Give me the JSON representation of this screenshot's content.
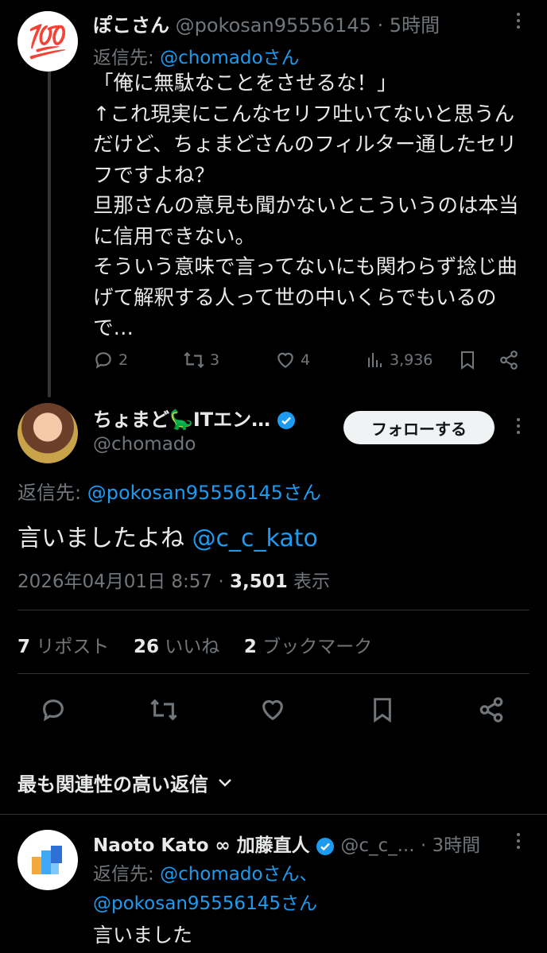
{
  "tweet1": {
    "author_name": "ぽこさん",
    "author_handle": "@pokosan95556145",
    "sep": "·",
    "time": "5時間",
    "reply_prefix": "返信先: ",
    "reply_to": "@chomadoさん",
    "avatar_emoji": "💯",
    "body": "「俺に無駄なことをさせるな！」\n↑これ現実にこんなセリフ吐いてないと思うんだけど、ちょまどさんのフィルター通したセリフですよね？\n旦那さんの意見も聞かないとこういうのは本当に信用できない。\nそういう意味で言ってないにも関わらず捻じ曲げて解釈する人って世の中いくらでもいるので…",
    "replies": "2",
    "reposts": "3",
    "likes": "4",
    "views": "3,936"
  },
  "tweet2": {
    "author_name": "ちょまど🦕ITエン…",
    "author_handle": "@chomado",
    "follow_label": "フォローする",
    "reply_prefix": "返信先: ",
    "reply_to": "@pokosan95556145さん",
    "body_text": "言いましたよね ",
    "body_mention": "@c_c_kato",
    "date": "2026年04月01日 8:57",
    "sep": "·",
    "views_count": "3,501",
    "views_label": " 表示",
    "reposts_count": "7",
    "reposts_label": " リポスト",
    "likes_count": "26",
    "likes_label": " いいね",
    "bookmarks_count": "2",
    "bookmarks_label": " ブックマーク"
  },
  "sort": {
    "label": "最も関連性の高い返信"
  },
  "tweet3": {
    "author_name": "Naoto Kato ∞ 加藤直人",
    "author_handle": "@c_c_...",
    "sep": "·",
    "time": "3時間",
    "reply_prefix": "返信先: ",
    "reply_to_1": "@chomadoさん、",
    "reply_to_2": "@pokosan95556145さん",
    "body": "言いました"
  },
  "colors": {
    "background": "#000000",
    "text": "#e7e9ea",
    "muted": "#71767b",
    "link": "#1d9bf0",
    "verified": "#1d9bf0"
  }
}
